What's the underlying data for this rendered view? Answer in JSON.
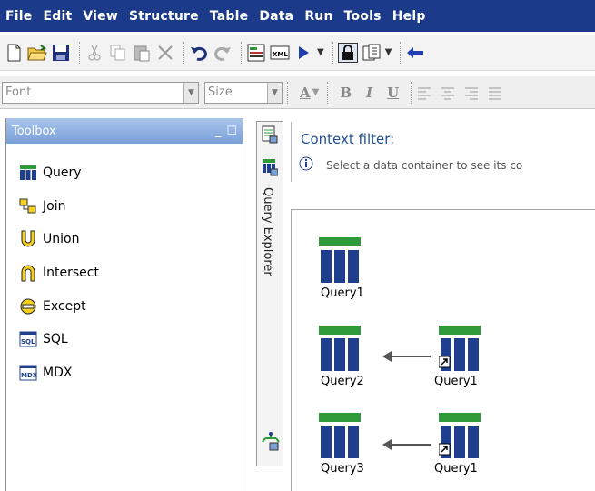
{
  "menu": [
    "File",
    "Edit",
    "View",
    "Structure",
    "Table",
    "Data",
    "Run",
    "Tools",
    "Help"
  ],
  "format_bar": {
    "font_placeholder": "Font",
    "size_placeholder": "Size",
    "bold": "B",
    "italic": "I",
    "underline": "U",
    "font_color": "A"
  },
  "toolbox": {
    "title": "Toolbox",
    "items": [
      {
        "label": "Query",
        "icon": "query-icon"
      },
      {
        "label": "Join",
        "icon": "join-icon"
      },
      {
        "label": "Union",
        "icon": "union-icon"
      },
      {
        "label": "Intersect",
        "icon": "intersect-icon"
      },
      {
        "label": "Except",
        "icon": "except-icon"
      },
      {
        "label": "SQL",
        "icon": "sql-icon"
      },
      {
        "label": "MDX",
        "icon": "mdx-icon"
      }
    ]
  },
  "side_strip": {
    "label": "Query Explorer"
  },
  "context_filter": {
    "title": "Context filter:",
    "info": "Select a data container to see its co"
  },
  "canvas": {
    "queries": [
      {
        "name": "Query1"
      },
      {
        "name": "Query2",
        "source": "Query1"
      },
      {
        "name": "Query3",
        "source": "Query1"
      }
    ]
  },
  "colors": {
    "menubar": "#1b3a8a",
    "panel_header": "#7aa0d8",
    "context_title": "#1f4d99",
    "query_green": "#2e9a3a",
    "query_blue": "#1f3f8e"
  }
}
